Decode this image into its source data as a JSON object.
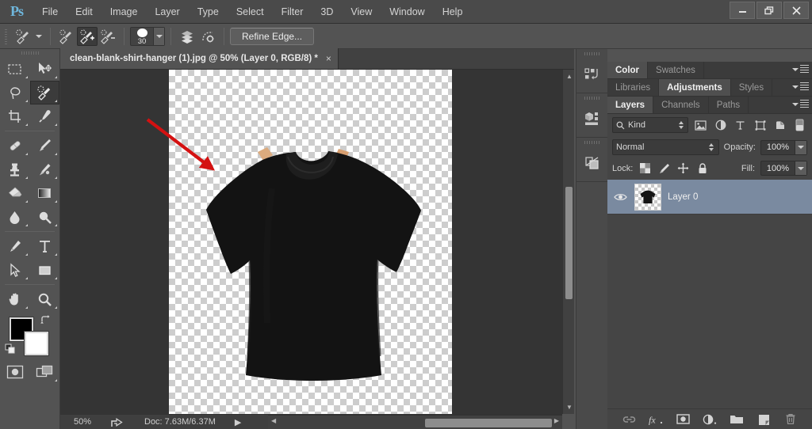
{
  "app": {
    "name": "Adobe Photoshop",
    "logo_text": "Ps"
  },
  "menubar": {
    "items": [
      {
        "label": "File"
      },
      {
        "label": "Edit"
      },
      {
        "label": "Image"
      },
      {
        "label": "Layer"
      },
      {
        "label": "Type"
      },
      {
        "label": "Select"
      },
      {
        "label": "Filter"
      },
      {
        "label": "3D"
      },
      {
        "label": "View"
      },
      {
        "label": "Window"
      },
      {
        "label": "Help"
      }
    ]
  },
  "window_controls": {
    "minimize": "–",
    "restore": "❐",
    "close": "✕"
  },
  "options_bar": {
    "tool_name": "quick-selection-tool",
    "modes": [
      {
        "name": "new-selection",
        "active": false
      },
      {
        "name": "add-to-selection",
        "active": true
      },
      {
        "name": "subtract-from-selection",
        "active": false
      }
    ],
    "brush_size": "30",
    "sample_all_layers": "Sample All Layers",
    "auto_enhance": "Auto-Enhance",
    "refine_edge_label": "Refine Edge..."
  },
  "toolbar": {
    "tools": [
      {
        "name": "rectangular-marquee-tool",
        "selected": false
      },
      {
        "name": "move-tool",
        "selected": false
      },
      {
        "name": "lasso-tool",
        "selected": false
      },
      {
        "name": "quick-selection-tool",
        "selected": true
      },
      {
        "name": "crop-tool",
        "selected": false
      },
      {
        "name": "eyedropper-tool",
        "selected": false
      },
      {
        "name": "healing-brush-tool",
        "selected": false
      },
      {
        "name": "brush-tool",
        "selected": false
      },
      {
        "name": "clone-stamp-tool",
        "selected": false
      },
      {
        "name": "history-brush-tool",
        "selected": false
      },
      {
        "name": "eraser-tool",
        "selected": false
      },
      {
        "name": "gradient-tool",
        "selected": false
      },
      {
        "name": "blur-tool",
        "selected": false
      },
      {
        "name": "dodge-tool",
        "selected": false
      },
      {
        "name": "pen-tool",
        "selected": false
      },
      {
        "name": "type-tool",
        "selected": false
      },
      {
        "name": "path-selection-tool",
        "selected": false
      },
      {
        "name": "rectangle-shape-tool",
        "selected": false
      },
      {
        "name": "hand-tool",
        "selected": false
      },
      {
        "name": "zoom-tool",
        "selected": false
      }
    ],
    "foreground_color": "#000000",
    "background_color": "#ffffff",
    "quick_mask": "quick-mask-mode",
    "screen_mode": "screen-mode"
  },
  "document": {
    "tab_title": "clean-blank-shirt-hanger (1).jpg @ 50% (Layer 0, RGB/8) *",
    "close_glyph": "×"
  },
  "canvas": {
    "annotation": {
      "type": "arrow",
      "color": "#d41111"
    },
    "artwork_name": "black-cropped-tshirt-on-hanger",
    "shirt_color": "#121212",
    "hanger_clip_color": "#d8a878"
  },
  "status_bar": {
    "zoom": "50%",
    "share_icon": "share-icon",
    "doc_info": "Doc: 7.63M/6.37M",
    "play_glyph": "▶"
  },
  "collapsed_rail": {
    "items": [
      {
        "name": "history-panel-icon"
      },
      {
        "name": "properties-panel-icon"
      },
      {
        "name": "layer-comps-panel-icon"
      }
    ]
  },
  "panels": {
    "group_color": {
      "tabs": [
        {
          "label": "Color",
          "active": true
        },
        {
          "label": "Swatches",
          "active": false
        }
      ]
    },
    "group_adjustments": {
      "tabs": [
        {
          "label": "Libraries",
          "active": false
        },
        {
          "label": "Adjustments",
          "active": true
        },
        {
          "label": "Styles",
          "active": false
        }
      ]
    },
    "group_layers": {
      "tabs": [
        {
          "label": "Layers",
          "active": true
        },
        {
          "label": "Channels",
          "active": false
        },
        {
          "label": "Paths",
          "active": false
        }
      ],
      "filter": {
        "label": "Kind",
        "icons": [
          {
            "name": "filter-pixel-layers-icon"
          },
          {
            "name": "filter-adjustment-layers-icon"
          },
          {
            "name": "filter-type-layers-icon"
          },
          {
            "name": "filter-shape-layers-icon"
          },
          {
            "name": "filter-smart-object-icon"
          },
          {
            "name": "filter-toggle-icon"
          }
        ]
      },
      "blend_mode": "Normal",
      "opacity_label": "Opacity:",
      "opacity_value": "100%",
      "lock_label": "Lock:",
      "lock_icons": [
        {
          "name": "lock-transparent-pixels-icon"
        },
        {
          "name": "lock-image-pixels-icon"
        },
        {
          "name": "lock-position-icon"
        },
        {
          "name": "lock-all-icon"
        }
      ],
      "fill_label": "Fill:",
      "fill_value": "100%",
      "layers": [
        {
          "name": "Layer 0",
          "visible": true,
          "selected": true
        }
      ],
      "footer_icons": [
        {
          "name": "link-layers-icon"
        },
        {
          "name": "layer-style-fx-icon"
        },
        {
          "name": "add-layer-mask-icon"
        },
        {
          "name": "new-adjustment-layer-icon"
        },
        {
          "name": "new-group-icon"
        },
        {
          "name": "new-layer-icon"
        },
        {
          "name": "delete-layer-icon"
        }
      ]
    }
  }
}
